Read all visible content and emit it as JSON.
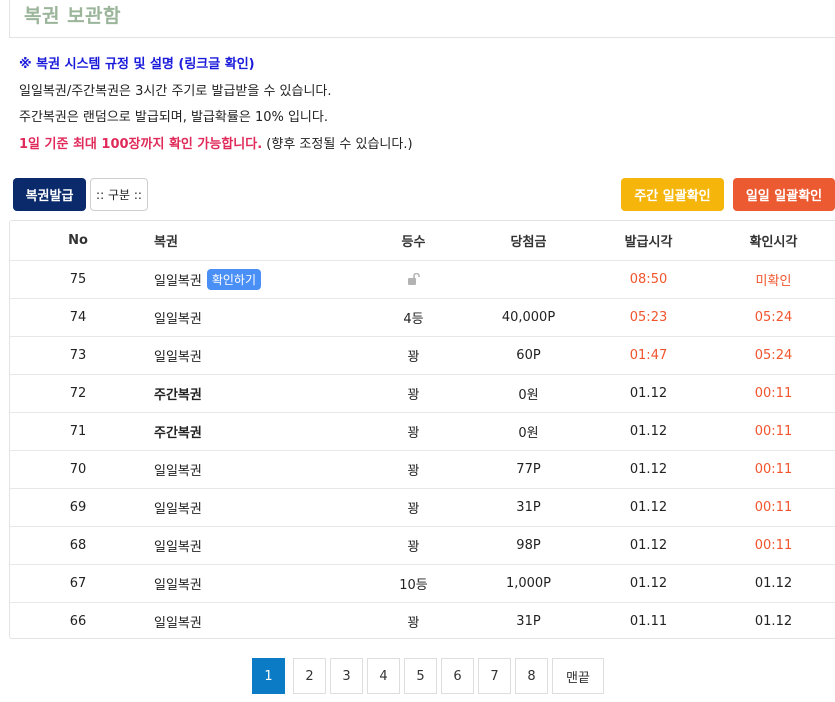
{
  "page_title": "복권 보관함",
  "info": {
    "rules_link": "※ 복권 시스템 규정 및 설명 (링크글 확인)",
    "line1": "일일복권/주간복권은 3시간 주기로 발급받을 수 있습니다.",
    "line2": "주간복권은 랜덤으로 발급되며, 발급확률은 10% 입니다.",
    "line3_strong": "1일 기준 최대 100장까지 확인 가능합니다.",
    "line3_rest": " (향후 조정될 수 있습니다.)"
  },
  "toolbar": {
    "issue_label": "복권발급",
    "filter_label": ":: 구분 ::",
    "weekly_confirm_label": "주간 일괄확인",
    "daily_confirm_label": "일일 일괄확인"
  },
  "table": {
    "headers": [
      "No",
      "복권",
      "등수",
      "당첨금",
      "발급시각",
      "확인시각"
    ],
    "confirm_badge": "확인하기",
    "rows": [
      {
        "no": "75",
        "name": "일일복권",
        "rank": "",
        "prize": "",
        "issued": "08:50",
        "checked": "미확인"
      },
      {
        "no": "74",
        "name": "일일복권",
        "rank": "4등",
        "prize": "40,000P",
        "issued": "05:23",
        "checked": "05:24"
      },
      {
        "no": "73",
        "name": "일일복권",
        "rank": "꽝",
        "prize": "60P",
        "issued": "01:47",
        "checked": "05:24"
      },
      {
        "no": "72",
        "name": "주간복권",
        "rank": "꽝",
        "prize": "0원",
        "issued": "01.12",
        "checked": "00:11"
      },
      {
        "no": "71",
        "name": "주간복권",
        "rank": "꽝",
        "prize": "0원",
        "issued": "01.12",
        "checked": "00:11"
      },
      {
        "no": "70",
        "name": "일일복권",
        "rank": "꽝",
        "prize": "77P",
        "issued": "01.12",
        "checked": "00:11"
      },
      {
        "no": "69",
        "name": "일일복권",
        "rank": "꽝",
        "prize": "31P",
        "issued": "01.12",
        "checked": "00:11"
      },
      {
        "no": "68",
        "name": "일일복권",
        "rank": "꽝",
        "prize": "98P",
        "issued": "01.12",
        "checked": "00:11"
      },
      {
        "no": "67",
        "name": "일일복권",
        "rank": "10등",
        "prize": "1,000P",
        "issued": "01.12",
        "checked": "01.12"
      },
      {
        "no": "66",
        "name": "일일복권",
        "rank": "꽝",
        "prize": "31P",
        "issued": "01.11",
        "checked": "01.12"
      }
    ]
  },
  "pagination": {
    "pages": [
      "1",
      "2",
      "3",
      "4",
      "5",
      "6",
      "7",
      "8"
    ],
    "active": "1",
    "last_label": "맨끝"
  },
  "colors": {
    "title": "#9bb59b",
    "rules_link": "#1a1adb",
    "highlight_red": "#e02b5a",
    "time_orange": "#f0552e",
    "issue_button": "#0a2a6b",
    "weekly_button": "#f5b50a",
    "daily_button": "#ec5a32",
    "active_page": "#0a7bc4"
  }
}
